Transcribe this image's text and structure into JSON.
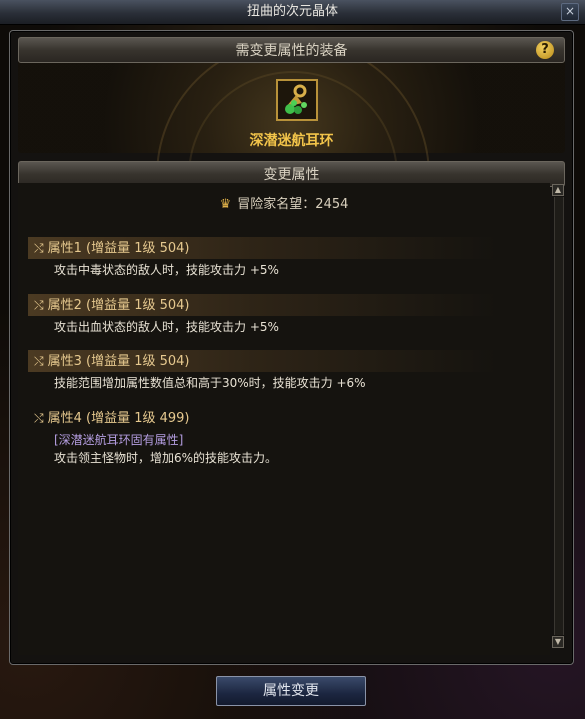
{
  "window": {
    "title": "扭曲的次元晶体",
    "close_glyph": "×"
  },
  "equip_section": {
    "header": "需变更属性的装备",
    "help_glyph": "?",
    "item_icon": "earring-item-icon",
    "item_name": "深潜迷航耳环"
  },
  "attr_section": {
    "header": "变更属性",
    "fame_label": "冒险家名望",
    "fame_separator": "：",
    "fame_value": "2454",
    "attributes": [
      {
        "title": "属性1 (增益量 1级 504)",
        "desc": "攻击中毒状态的敌人时，技能攻击力 +5%",
        "note": ""
      },
      {
        "title": "属性2 (增益量 1级 504)",
        "desc": "攻击出血状态的敌人时，技能攻击力 +5%",
        "note": ""
      },
      {
        "title": "属性3 (增益量 1级 504)",
        "desc": "技能范围增加属性数值总和高于30%时，技能攻击力 +6%",
        "note": ""
      },
      {
        "title": "属性4 (增益量 1级 499)",
        "desc": "攻击领主怪物时，增加6%的技能攻击力。",
        "note": "[深潜迷航耳环固有属性]"
      }
    ]
  },
  "footer": {
    "change_button": "属性变更"
  },
  "colors": {
    "item_name": "#f2c44a",
    "attr_title": "#e6c98f",
    "fixed_note": "#b49de0"
  }
}
